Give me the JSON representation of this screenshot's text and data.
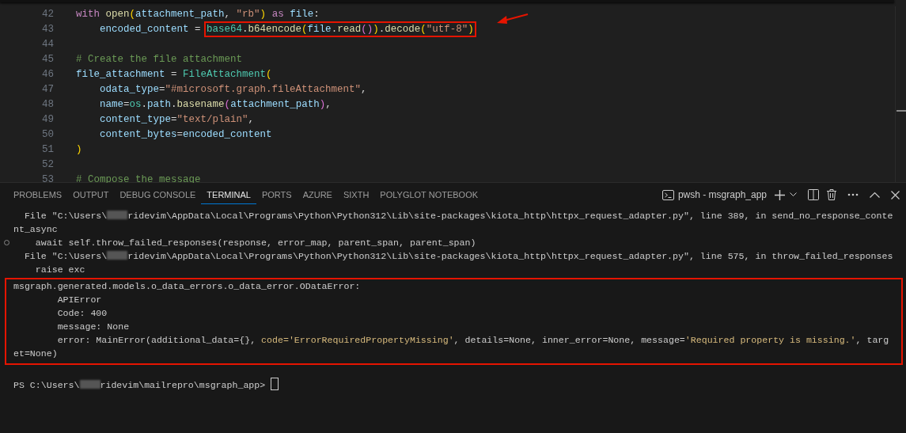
{
  "editor": {
    "lines": [
      {
        "number": "42",
        "tokens": [
          {
            "t": "    with ",
            "kind": "kw"
          },
          {
            "t": "open",
            "kind": "fn"
          },
          {
            "t": "(",
            "kind": "br1"
          },
          {
            "t": "attachment_path",
            "kind": "var"
          },
          {
            "t": ", ",
            "kind": "op"
          },
          {
            "t": "\"rb\"",
            "kind": "str"
          },
          {
            "t": ")",
            "kind": "br1"
          },
          {
            "t": " as ",
            "kind": "kw"
          },
          {
            "t": "file",
            "kind": "var"
          },
          {
            "t": ":",
            "kind": "op"
          }
        ]
      },
      {
        "number": "43",
        "tokens": [
          {
            "t": "        encoded_content",
            "kind": "var"
          },
          {
            "t": " = ",
            "kind": "op"
          }
        ],
        "boxed_tokens": [
          {
            "t": "base64",
            "kind": "cls"
          },
          {
            "t": ".",
            "kind": "op"
          },
          {
            "t": "b64encode",
            "kind": "fn"
          },
          {
            "t": "(",
            "kind": "br1"
          },
          {
            "t": "file",
            "kind": "var"
          },
          {
            "t": ".",
            "kind": "op"
          },
          {
            "t": "read",
            "kind": "fn"
          },
          {
            "t": "(",
            "kind": "br2"
          },
          {
            "t": ")",
            "kind": "br2"
          },
          {
            "t": ")",
            "kind": "br1"
          },
          {
            "t": ".",
            "kind": "op"
          },
          {
            "t": "decode",
            "kind": "fn"
          },
          {
            "t": "(",
            "kind": "br1"
          },
          {
            "t": "\"utf-8\"",
            "kind": "str"
          },
          {
            "t": ")",
            "kind": "br1"
          }
        ],
        "arrow": true
      },
      {
        "number": "44"
      },
      {
        "number": "45",
        "tokens": [
          {
            "t": "    # Create the file attachment",
            "kind": "cmt"
          }
        ]
      },
      {
        "number": "46",
        "tokens": [
          {
            "t": "    file_attachment",
            "kind": "var"
          },
          {
            "t": " = ",
            "kind": "op"
          },
          {
            "t": "FileAttachment",
            "kind": "cls"
          },
          {
            "t": "(",
            "kind": "br1"
          }
        ]
      },
      {
        "number": "47",
        "tokens": [
          {
            "t": "        odata_type",
            "kind": "var"
          },
          {
            "t": "=",
            "kind": "op"
          },
          {
            "t": "\"#microsoft.graph.fileAttachment\"",
            "kind": "str"
          },
          {
            "t": ",",
            "kind": "op"
          }
        ]
      },
      {
        "number": "48",
        "tokens": [
          {
            "t": "        name",
            "kind": "var"
          },
          {
            "t": "=",
            "kind": "op"
          },
          {
            "t": "os",
            "kind": "cls"
          },
          {
            "t": ".",
            "kind": "op"
          },
          {
            "t": "path",
            "kind": "var"
          },
          {
            "t": ".",
            "kind": "op"
          },
          {
            "t": "basename",
            "kind": "fn"
          },
          {
            "t": "(",
            "kind": "br2"
          },
          {
            "t": "attachment_path",
            "kind": "var"
          },
          {
            "t": ")",
            "kind": "br2"
          },
          {
            "t": ",",
            "kind": "op"
          }
        ]
      },
      {
        "number": "49",
        "tokens": [
          {
            "t": "        content_type",
            "kind": "var"
          },
          {
            "t": "=",
            "kind": "op"
          },
          {
            "t": "\"text/plain\"",
            "kind": "str"
          },
          {
            "t": ",",
            "kind": "op"
          }
        ]
      },
      {
        "number": "50",
        "tokens": [
          {
            "t": "        content_bytes",
            "kind": "var"
          },
          {
            "t": "=",
            "kind": "op"
          },
          {
            "t": "encoded_content",
            "kind": "var"
          }
        ]
      },
      {
        "number": "51",
        "tokens": [
          {
            "t": "    )",
            "kind": "br1"
          }
        ]
      },
      {
        "number": "52"
      },
      {
        "number": "53",
        "tokens": [
          {
            "t": "    # Compose the message",
            "kind": "cmt"
          }
        ]
      }
    ]
  },
  "panel": {
    "tabs": [
      {
        "label": "PROBLEMS",
        "selected": false
      },
      {
        "label": "OUTPUT",
        "selected": false
      },
      {
        "label": "DEBUG CONSOLE",
        "selected": false
      },
      {
        "label": "TERMINAL",
        "selected": true
      },
      {
        "label": "PORTS",
        "selected": false
      },
      {
        "label": "AZURE",
        "selected": false
      },
      {
        "label": "SIXTH",
        "selected": false
      },
      {
        "label": "POLYGLOT NOTEBOOK",
        "selected": false
      }
    ],
    "session_label": "pwsh - msgraph_app",
    "terminal": {
      "lines": [
        {
          "marker": false,
          "segments": [
            {
              "t": "  File \"C:\\Users\\",
              "kind": "plain"
            },
            {
              "kind": "redacted"
            },
            {
              "t": "ridevim\\AppData\\Local\\Programs\\Python\\Python312\\Lib\\site-packages\\kiota_http\\httpx_request_adapter.py\", line 389, in send_no_response_conte",
              "kind": "plain"
            }
          ]
        },
        {
          "marker": false,
          "segments": [
            {
              "t": "nt_async",
              "kind": "plain"
            }
          ]
        },
        {
          "marker": true,
          "segments": [
            {
              "t": "    await self.throw_failed_responses(response, error_map, parent_span, parent_span)",
              "kind": "plain"
            }
          ]
        },
        {
          "marker": false,
          "segments": [
            {
              "t": "  File \"C:\\Users\\",
              "kind": "plain"
            },
            {
              "kind": "redacted"
            },
            {
              "t": "ridevim\\AppData\\Local\\Programs\\Python\\Python312\\Lib\\site-packages\\kiota_http\\httpx_request_adapter.py\", line 575, in throw_failed_responses",
              "kind": "plain"
            }
          ]
        },
        {
          "marker": false,
          "segments": [
            {
              "t": "    raise exc",
              "kind": "plain"
            }
          ]
        }
      ],
      "error_box": [
        {
          "marker": false,
          "segments": [
            {
              "t": "msgraph.generated.models.o_data_errors.o_data_error.ODataError:",
              "kind": "plain"
            }
          ]
        },
        {
          "marker": false,
          "segments": [
            {
              "t": "        APIError",
              "kind": "plain"
            }
          ]
        },
        {
          "marker": false,
          "segments": [
            {
              "t": "        Code: 400",
              "kind": "plain"
            }
          ]
        },
        {
          "marker": false,
          "segments": [
            {
              "t": "        message: None",
              "kind": "plain"
            }
          ]
        },
        {
          "marker": false,
          "segments": [
            {
              "t": "        error: MainError(additional_data={}, ",
              "kind": "plain"
            },
            {
              "t": "code='ErrorRequiredPropertyMissing'",
              "kind": "str"
            },
            {
              "t": ", details=None, inner_error=None, message=",
              "kind": "plain"
            },
            {
              "t": "'Required property is missing.'",
              "kind": "str"
            },
            {
              "t": ", targ",
              "kind": "plain"
            }
          ]
        },
        {
          "marker": false,
          "segments": [
            {
              "t": "et=None)",
              "kind": "plain"
            }
          ]
        }
      ],
      "prompt": {
        "marker": false,
        "segments": [
          {
            "t": "PS C:\\Users\\",
            "kind": "plain"
          },
          {
            "kind": "redacted"
          },
          {
            "t": "ridevim\\mailrepro\\msgraph_app> ",
            "kind": "plain"
          },
          {
            "kind": "cursor"
          }
        ]
      }
    }
  }
}
